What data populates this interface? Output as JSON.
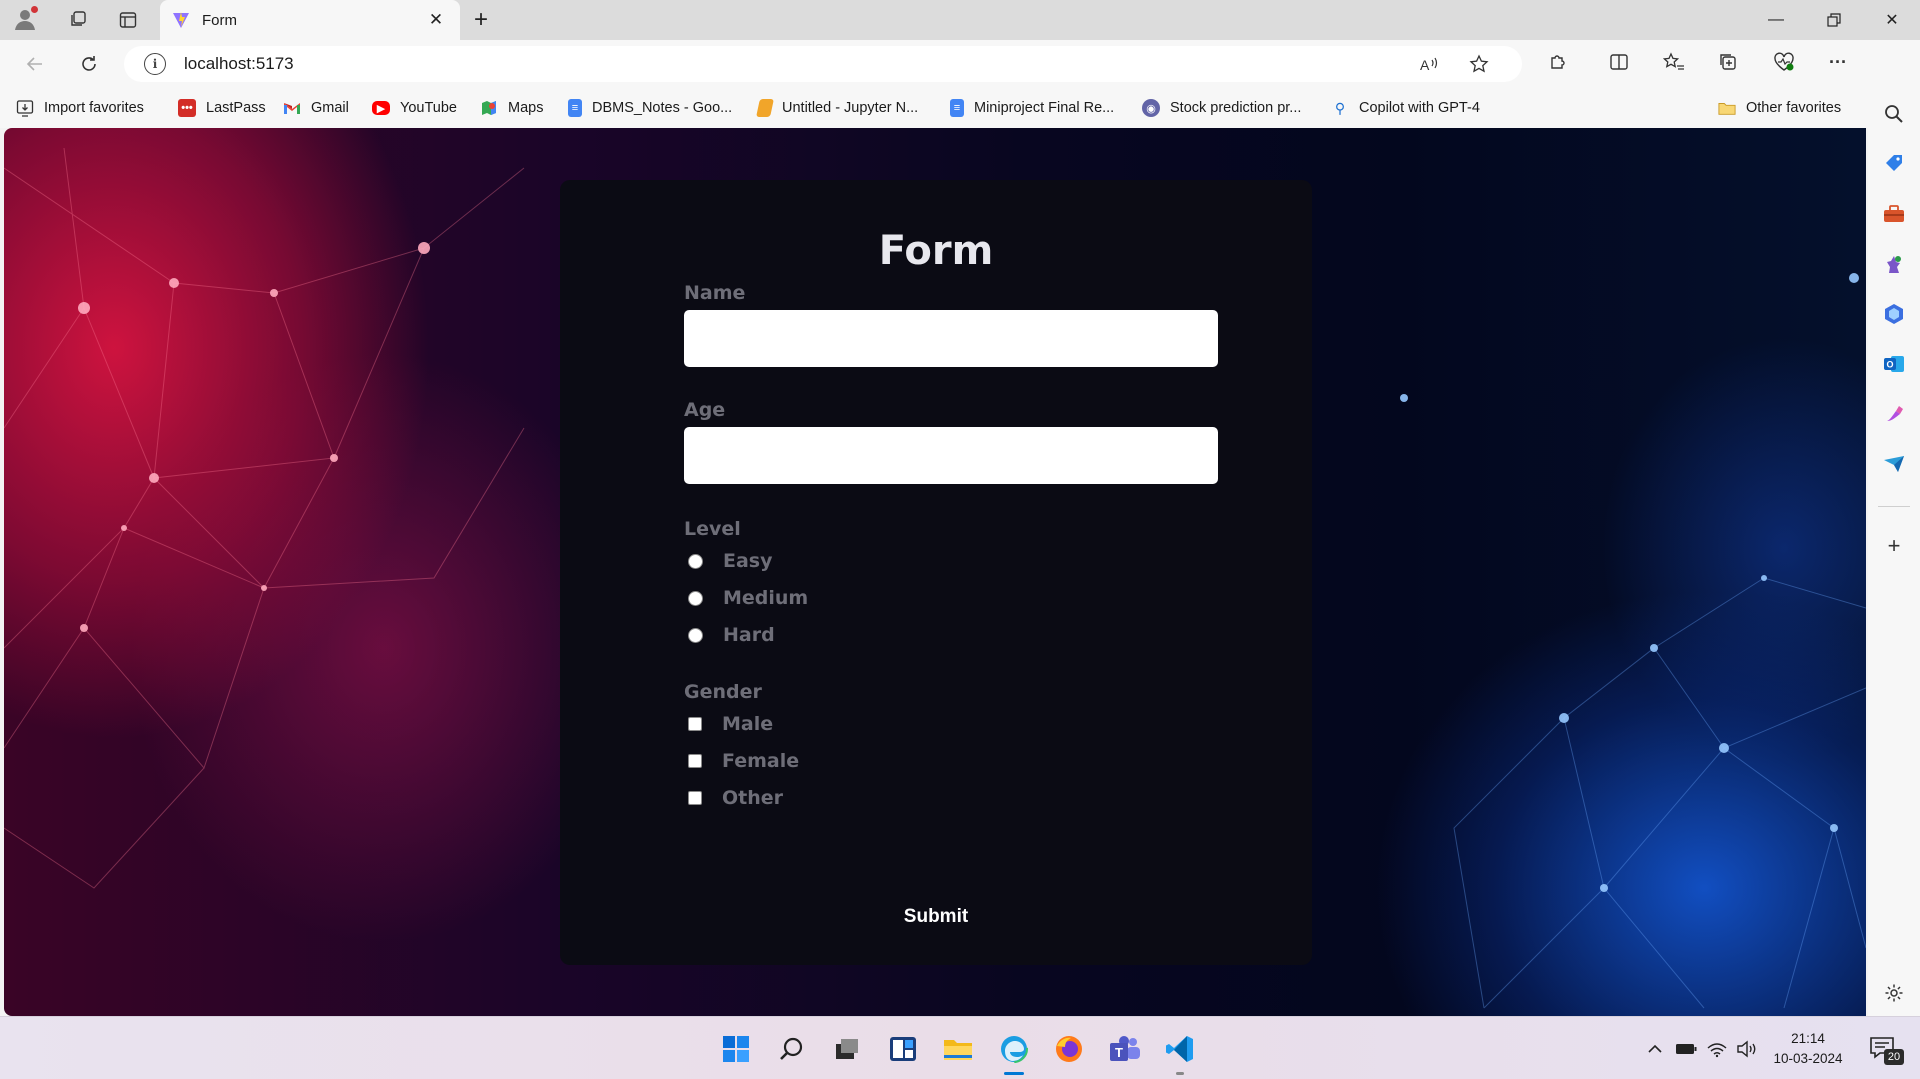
{
  "browser": {
    "tab_title": "Form",
    "url": "localhost:5173",
    "bookmarks": [
      "Import favorites",
      "LastPass",
      "Gmail",
      "YouTube",
      "Maps",
      "DBMS_Notes - Goo...",
      "Untitled - Jupyter N...",
      "Miniproject Final Re...",
      "Stock prediction pr...",
      "Copilot with GPT-4"
    ],
    "other_favorites": "Other favorites"
  },
  "form": {
    "title": "Form",
    "name_label": "Name",
    "name_value": "",
    "age_label": "Age",
    "age_value": "",
    "level_label": "Level",
    "level_options": [
      "Easy",
      "Medium",
      "Hard"
    ],
    "gender_label": "Gender",
    "gender_options": [
      "Male",
      "Female",
      "Other"
    ],
    "submit_label": "Submit"
  },
  "taskbar": {
    "time": "21:14",
    "date": "10-03-2024",
    "notification_count": "20"
  },
  "colors": {
    "form_bg": "#0b0b14",
    "label": "#6e6e78",
    "accent_edge": "#0078d4"
  }
}
